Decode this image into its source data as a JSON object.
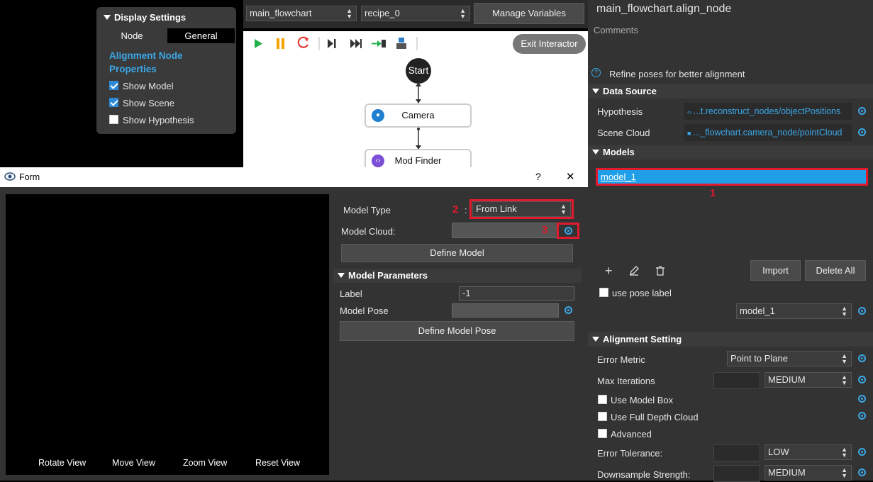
{
  "display_settings": {
    "title": "Display Settings",
    "tabs": [
      "Node",
      "General"
    ],
    "heading": "Alignment Node Properties",
    "checkboxes": [
      {
        "label": "Show Model",
        "checked": true
      },
      {
        "label": "Show Scene",
        "checked": true
      },
      {
        "label": "Show Hypothesis",
        "checked": false
      }
    ]
  },
  "toolbar": {
    "flowchart_select": "main_flowchart",
    "recipe_select": "recipe_0",
    "manage_vars": "Manage Variables",
    "exit_interactor": "Exit Interactor"
  },
  "flowchart": {
    "start": "Start",
    "nodes": [
      "Camera",
      "Mod Finder"
    ]
  },
  "right_panel": {
    "node_title": "main_flowchart.align_node",
    "comments_label": "Comments",
    "help_text": "Refine poses for better alignment",
    "data_source": {
      "heading": "Data Source",
      "hypothesis_label": "Hypothesis",
      "hypothesis_link": "...t.reconstruct_nodes/objectPositions",
      "scene_cloud_label": "Scene Cloud",
      "scene_cloud_link": "..._flowchart.camera_node/pointCloud"
    },
    "models": {
      "heading": "Models",
      "items": [
        "model_1"
      ],
      "annotation": "1",
      "import_btn": "Import",
      "delete_all_btn": "Delete All",
      "use_pose_label": "use pose label",
      "model_select": "model_1"
    },
    "alignment": {
      "heading": "Alignment Setting",
      "error_metric_label": "Error Metric",
      "error_metric_value": "Point to Plane",
      "max_iter_label": "Max Iterations",
      "max_iter_value": "MEDIUM",
      "use_model_box": "Use Model Box",
      "use_full_depth": "Use Full Depth Cloud",
      "advanced": "Advanced",
      "error_tol_label": "Error Tolerance:",
      "error_tol_value": "LOW",
      "downsample_label": "Downsample Strength:",
      "downsample_value": "MEDIUM"
    }
  },
  "form": {
    "title": "Form",
    "help": "?",
    "close": "✕",
    "view_buttons": [
      "Rotate View",
      "Move View",
      "Zoom View",
      "Reset View"
    ],
    "model_type_label": "Model Type",
    "model_type_num": "2",
    "colon": ":",
    "model_type_value": "From Link",
    "model_cloud_label": "Model Cloud:",
    "model_cloud_num": "3",
    "define_model": "Define Model",
    "params_heading": "Model Parameters",
    "label_label": "Label",
    "label_value": "-1",
    "pose_label": "Model Pose",
    "define_pose": "Define Model Pose"
  }
}
